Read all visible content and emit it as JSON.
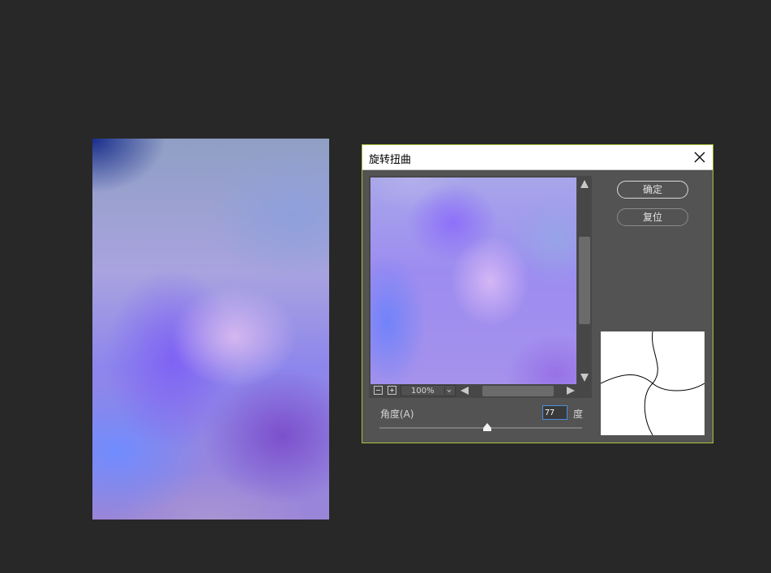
{
  "dialog": {
    "title": "旋转扭曲",
    "ok_label": "确定",
    "reset_label": "复位",
    "angle_label": "角度(A)",
    "angle_value": "77",
    "angle_unit": "度",
    "zoom_value": "100%",
    "accent_border": "#a9c23a"
  },
  "icons": {
    "close": "close-icon",
    "zoom_out": "zoom-out-icon",
    "zoom_in": "zoom-in-icon",
    "caret": "chevron-down-icon",
    "scroll_up": "arrow-up-icon",
    "scroll_down": "arrow-down-icon",
    "scroll_left": "arrow-left-icon",
    "scroll_right": "arrow-right-icon",
    "slider_thumb": "triangle-slider-icon"
  },
  "colors": {
    "workspace_bg": "#282828",
    "dialog_bg": "#535353",
    "input_border": "#4a90d9"
  }
}
